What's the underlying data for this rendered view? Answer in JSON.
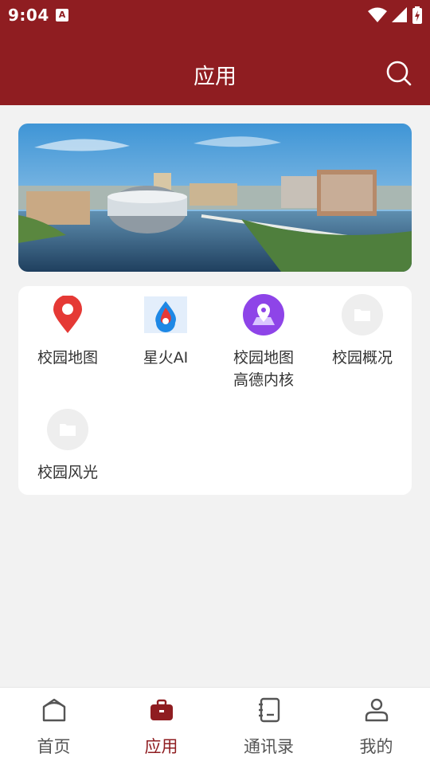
{
  "status_bar": {
    "time": "9:04",
    "notification_icon": "A"
  },
  "header": {
    "title": "应用"
  },
  "apps": [
    {
      "label": "校园地图",
      "icon": "map-pin-icon"
    },
    {
      "label": "星火AI",
      "icon": "spark-ai-icon"
    },
    {
      "label": "校园地图",
      "label2": "高德内核",
      "icon": "map-purple-icon"
    },
    {
      "label": "校园概况",
      "icon": "folder-icon"
    },
    {
      "label": "校园风光",
      "icon": "folder-icon"
    }
  ],
  "tabbar": {
    "tabs": [
      {
        "label": "首页",
        "icon": "home-icon"
      },
      {
        "label": "应用",
        "icon": "briefcase-icon",
        "active": true
      },
      {
        "label": "通讯录",
        "icon": "contacts-icon"
      },
      {
        "label": "我的",
        "icon": "user-icon"
      }
    ]
  },
  "colors": {
    "brand": "#8f1d21",
    "background": "#f2f2f2"
  }
}
